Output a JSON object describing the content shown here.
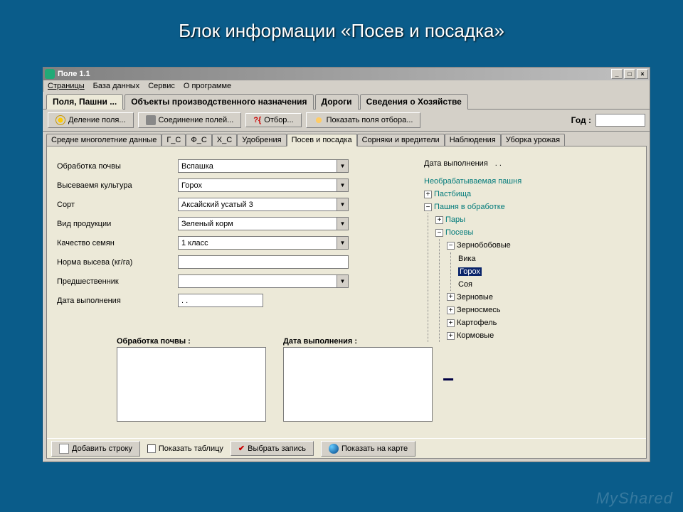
{
  "slide_title": "Блок информации «Посев и посадка»",
  "window": {
    "title": "Поле 1.1"
  },
  "menu": {
    "pages": "Страницы",
    "db": "База данных",
    "service": "Сервис",
    "about": "О программе"
  },
  "main_tabs": {
    "fields": "Поля, Пашни ...",
    "objects": "Объекты производственного назначения",
    "roads": "Дороги",
    "farm_info": "Сведения о Хозяйстве"
  },
  "toolbar": {
    "split_field": "Деление поля...",
    "join_fields": "Соединение полей...",
    "filter": "Отбор...",
    "show_filter": "Показать поля отбора...",
    "year_label": "Год :",
    "year_value": ""
  },
  "sub_tabs": {
    "avg": "Средне многолетние данные",
    "gs": "Г_С",
    "fs": "Ф_С",
    "hs": "Х_С",
    "fert": "Удобрения",
    "sowing": "Посев и посадка",
    "weeds": "Сорняки и вредители",
    "obs": "Наблюдения",
    "harvest": "Уборка урожая"
  },
  "form": {
    "soil_treatment": {
      "label": "Обработка почвы",
      "value": "Вспашка"
    },
    "crop": {
      "label": "Высеваемя культура",
      "value": "Горох"
    },
    "variety": {
      "label": "Сорт",
      "value": "Аксайский усатый 3"
    },
    "product_type": {
      "label": "Вид продукции",
      "value": "Зеленый корм"
    },
    "seed_quality": {
      "label": "Качество семян",
      "value": "1 класс"
    },
    "seed_rate": {
      "label": "Норма высева (кг/га)",
      "value": ""
    },
    "predecessor": {
      "label": "Предшественник",
      "value": ""
    },
    "exec_date": {
      "label": "Дата выполнения",
      "value": " . ."
    },
    "right_date_label": "Дата выполнения",
    "right_date_value": " . ."
  },
  "lists": {
    "soil_header": "Обработка почвы :",
    "date_header": "Дата выполнения :"
  },
  "tree": {
    "n1": "Необрабатываемая пашня",
    "n2": "Пастбища",
    "n3": "Пашня в обработке",
    "n3a": "Пары",
    "n3b": "Посевы",
    "n3b1": "Зернобобовые",
    "n3b1a": "Вика",
    "n3b1b": "Горох",
    "n3b1c": "Соя",
    "n3b2": "Зерновые",
    "n3b3": "Зерносмесь",
    "n3b4": "Картофель",
    "n3b5": "Кормовые"
  },
  "footer": {
    "add_row": "Добавить строку",
    "show_table": "Показать таблицу",
    "select_record": "Выбрать запись",
    "show_map": "Показать на карте"
  },
  "watermark": "MyShared"
}
